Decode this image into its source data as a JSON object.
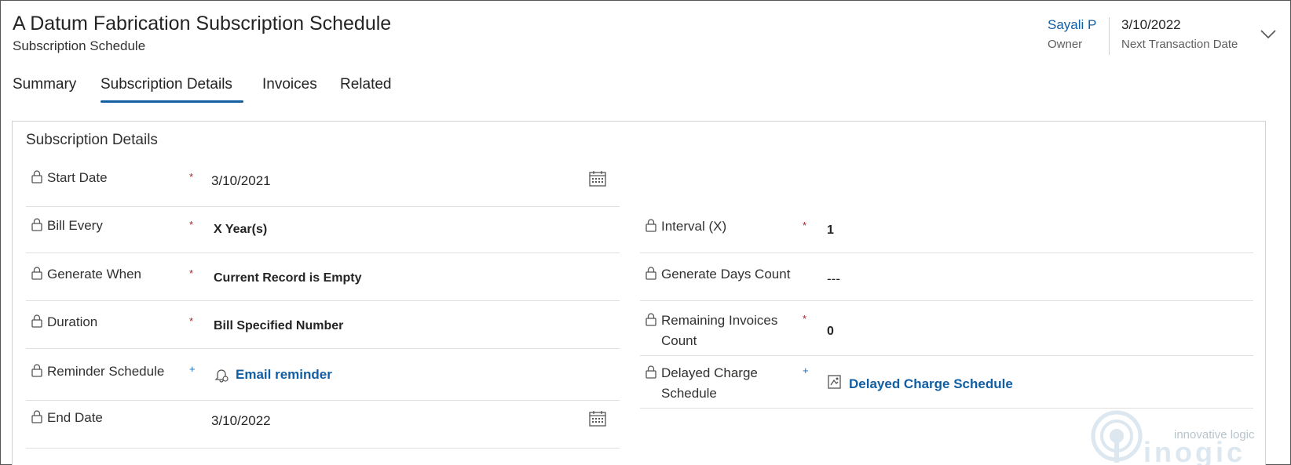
{
  "header": {
    "title": "A Datum Fabrication Subscription Schedule",
    "subtitle": "Subscription Schedule",
    "owner_value": "Sayali P",
    "owner_label": "Owner",
    "date_value": "3/10/2022",
    "date_label": "Next Transaction Date"
  },
  "tabs": [
    {
      "label": "Summary"
    },
    {
      "label": "Subscription Details"
    },
    {
      "label": "Invoices"
    },
    {
      "label": "Related"
    }
  ],
  "section": {
    "title": "Subscription Details"
  },
  "fields": {
    "start_date": {
      "label": "Start Date",
      "required": "*",
      "value": "3/10/2021"
    },
    "bill_every": {
      "label": "Bill Every",
      "required": "*",
      "value": "X Year(s)"
    },
    "generate_when": {
      "label": "Generate When",
      "required": "*",
      "value": "Current Record is Empty"
    },
    "duration": {
      "label": "Duration",
      "required": "*",
      "value": "Bill Specified Number"
    },
    "reminder_schedule": {
      "label": "Reminder Schedule",
      "recommended": "+",
      "value": "Email reminder"
    },
    "end_date": {
      "label": "End Date",
      "value": "3/10/2022"
    },
    "interval": {
      "label": "Interval (X)",
      "required": "*",
      "value": "1"
    },
    "generate_days_count": {
      "label": "Generate Days Count",
      "value": "---"
    },
    "remaining_invoices_count": {
      "label_line1": "Remaining Invoices",
      "label_line2": "Count",
      "required": "*",
      "value": "0"
    },
    "delayed_charge_schedule": {
      "label_line1": "Delayed Charge",
      "label_line2": "Schedule",
      "recommended": "+",
      "value": "Delayed Charge Schedule"
    }
  },
  "watermark": {
    "line1": "innovative logic",
    "line2": "inogic"
  },
  "colors": {
    "accent": "#115ea3",
    "required": "#a4262c"
  }
}
